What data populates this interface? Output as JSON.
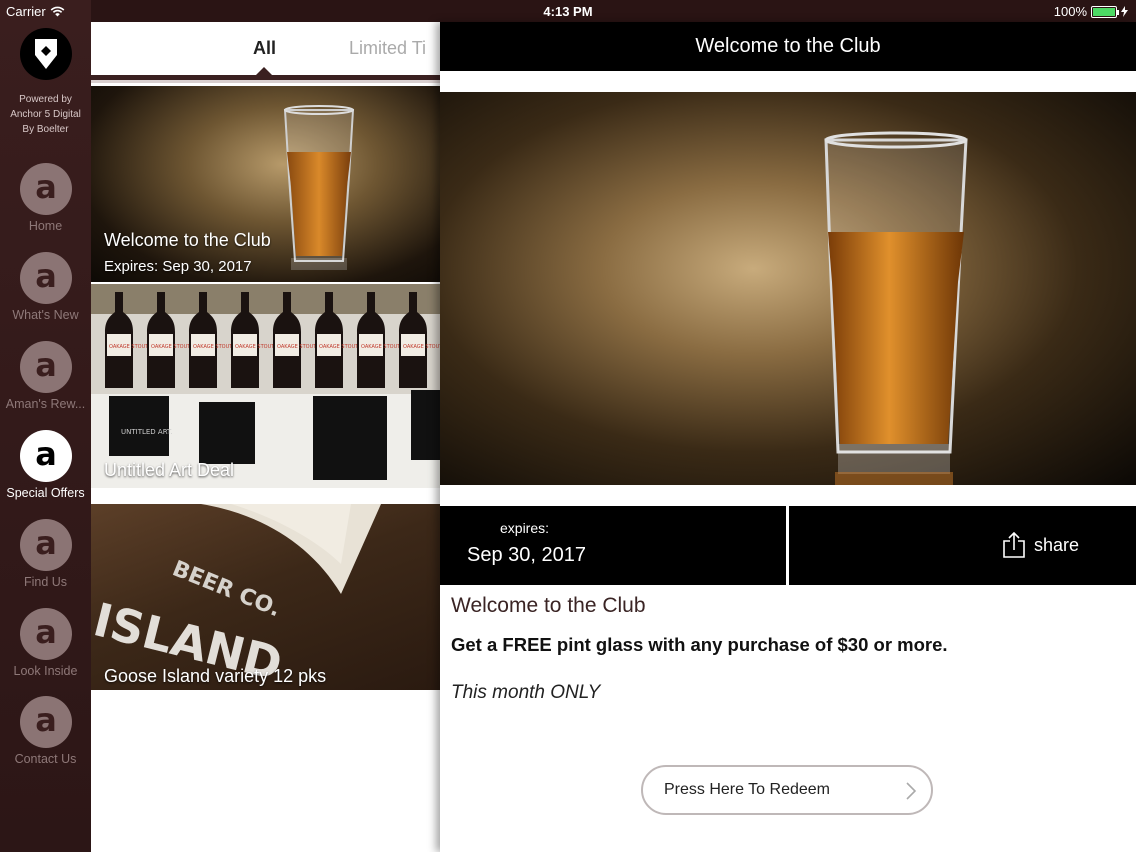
{
  "status_bar": {
    "carrier": "Carrier",
    "time": "4:13 PM",
    "battery": "100%",
    "battery_level": 1.0
  },
  "sidebar": {
    "powered_by": [
      "Powered by",
      "Anchor 5 Digital",
      "By Boelter"
    ],
    "items": [
      {
        "label": "Home",
        "icon": "a-logo-icon",
        "active": false
      },
      {
        "label": "What's New",
        "icon": "a-logo-icon",
        "active": false
      },
      {
        "label": "Aman's Rew...",
        "icon": "a-logo-icon",
        "active": false
      },
      {
        "label": "Special Offers",
        "icon": "a-logo-icon",
        "active": true
      },
      {
        "label": "Find Us",
        "icon": "a-logo-icon",
        "active": false
      },
      {
        "label": "Look Inside",
        "icon": "a-logo-icon",
        "active": false
      },
      {
        "label": "Contact Us",
        "icon": "a-logo-icon",
        "active": false
      }
    ],
    "icon_letter": "a"
  },
  "tabs": {
    "items": [
      "All",
      "Limited Ti"
    ],
    "selected": "All"
  },
  "deals": [
    {
      "title": "Welcome to the Club",
      "expires": "Expires: Sep 30, 2017"
    },
    {
      "title": "Untitled Art Deal"
    },
    {
      "title": "Goose Island variety 12 pks"
    }
  ],
  "photo_text": {
    "bottle_label": "OAKAGE STOUT",
    "box_label": "UNTITLED ART.",
    "sign_brand": "BEER CO.",
    "sign_name": "ISLAND"
  },
  "detail": {
    "header": "Welcome to the Club",
    "expires_label": "expires:",
    "expires_date": "Sep 30, 2017",
    "share_label": "share",
    "title": "Welcome to the Club",
    "description": "Get a FREE pint glass with any purchase of $30 or more.",
    "note": "This month ONLY",
    "redeem_label": "Press Here To Redeem"
  },
  "colors": {
    "sidebar_bg": "#3a1e1e",
    "accent_dark": "#3a2020",
    "header_bg": "#000000",
    "battery_green": "#4cd964"
  }
}
